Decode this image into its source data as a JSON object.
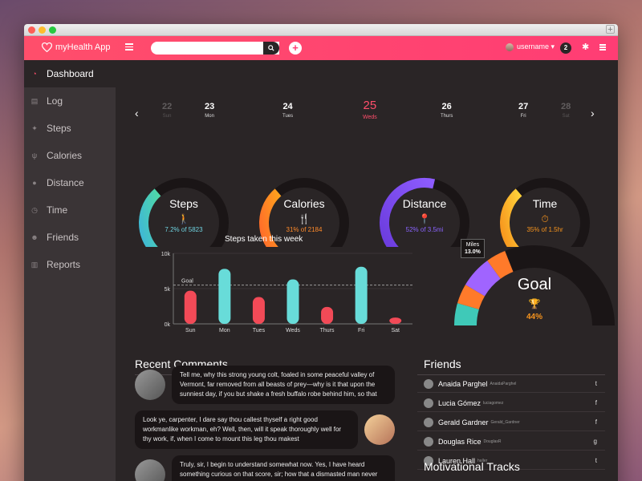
{
  "app": {
    "title": "myHealth App"
  },
  "topbar": {
    "search_placeholder": "",
    "add_label": "+",
    "username": "username ▾",
    "notifications": "2"
  },
  "sidebar": {
    "items": [
      {
        "label": "Dashboard",
        "icon": "dashboard-icon",
        "active": true
      },
      {
        "label": "Log",
        "icon": "document-icon"
      },
      {
        "label": "Steps",
        "icon": "walking-icon"
      },
      {
        "label": "Calories",
        "icon": "fork-knife-icon"
      },
      {
        "label": "Distance",
        "icon": "location-pin-icon"
      },
      {
        "label": "Time",
        "icon": "clock-icon"
      },
      {
        "label": "Friends",
        "icon": "people-icon"
      },
      {
        "label": "Reports",
        "icon": "chart-icon"
      }
    ]
  },
  "days": [
    {
      "num": "22",
      "lbl": "Sun"
    },
    {
      "num": "23",
      "lbl": "Mon"
    },
    {
      "num": "24",
      "lbl": "Tues"
    },
    {
      "num": "25",
      "lbl": "Weds"
    },
    {
      "num": "26",
      "lbl": "Thurs"
    },
    {
      "num": "27",
      "lbl": "Fri"
    },
    {
      "num": "28",
      "lbl": "Sat"
    }
  ],
  "gauges": [
    {
      "title": "Steps",
      "sub": "7.2% of 5823",
      "color_start": "#4fd8a8",
      "color_end": "#3fb7d6",
      "sub_color": "#6fd3e0",
      "fraction": 0.35
    },
    {
      "title": "Calories",
      "sub": "31% of 2184",
      "color_start": "#ffa11d",
      "color_end": "#ff6b2a",
      "sub_color": "#ff8a2a",
      "fraction": 0.35
    },
    {
      "title": "Distance",
      "sub": "52% of 3.5mi",
      "color_start": "#8e5cff",
      "color_end": "#6a3bdc",
      "sub_color": "#8a64ff",
      "fraction": 0.55
    },
    {
      "title": "Time",
      "sub": "35% of 1.5hr",
      "color_start": "#ffd23a",
      "color_end": "#f7941d",
      "sub_color": "#f7941d",
      "fraction": 0.35
    }
  ],
  "chart_data": {
    "type": "bar",
    "title": "Steps taken this week",
    "categories": [
      "Sun",
      "Mon",
      "Tues",
      "Weds",
      "Thurs",
      "Fri",
      "Sat"
    ],
    "values": [
      4700,
      7800,
      3800,
      6300,
      2400,
      8100,
      900
    ],
    "colors": [
      "#f24a57",
      "#68dcd9",
      "#f24a57",
      "#68dcd9",
      "#f24a57",
      "#68dcd9",
      "#f24a57"
    ],
    "ylim": [
      0,
      10000
    ],
    "yticks": [
      "0k",
      "5k",
      "10k"
    ],
    "goal_label": "Goal",
    "goal_value": 5500
  },
  "goal": {
    "title": "Goal",
    "pct": "44%",
    "tooltip_label": "Miles",
    "tooltip_value": "13.0%",
    "segments": [
      {
        "color": "#3fc9b8",
        "fraction": 0.09
      },
      {
        "color": "#ff7a2a",
        "fraction": 0.08
      },
      {
        "color": "#a064ff",
        "fraction": 0.13
      },
      {
        "color": "#ff7a2a",
        "fraction": 0.08
      }
    ]
  },
  "comments": {
    "title": "Recent Comments",
    "items": [
      {
        "text": "Tell me, why this strong young colt, foaled in some peaceful valley of Vermont, far removed from all beasts of prey—why is it that upon the sunniest day, if you but shake a fresh buffalo robe behind him, so that"
      },
      {
        "text": "Look ye, carpenter, I dare say thou callest thyself a right good workmanlike workman, eh? Well, then, will it speak thoroughly well for thy work, if, when I come to mount this leg thou makest"
      },
      {
        "text": "Truly, sir, I begin to understand somewhat now. Yes, I have heard something curious on that score, sir; how that a dismasted man never entirely loses the"
      }
    ]
  },
  "friends": {
    "title": "Friends",
    "items": [
      {
        "name": "Anaida Parghel",
        "handle": "AnaidaParghel",
        "social": "t"
      },
      {
        "name": "Lucia Gómez",
        "handle": "luciagomez",
        "social": "f"
      },
      {
        "name": "Gerald Gardner",
        "handle": "Gerald_Gardner",
        "social": "f"
      },
      {
        "name": "Douglas Rice",
        "handle": "DouglasR",
        "social": "g"
      },
      {
        "name": "Lauren Hall",
        "handle": "haller",
        "social": "t"
      }
    ]
  },
  "tracks": {
    "title": "Motivational Tracks"
  }
}
